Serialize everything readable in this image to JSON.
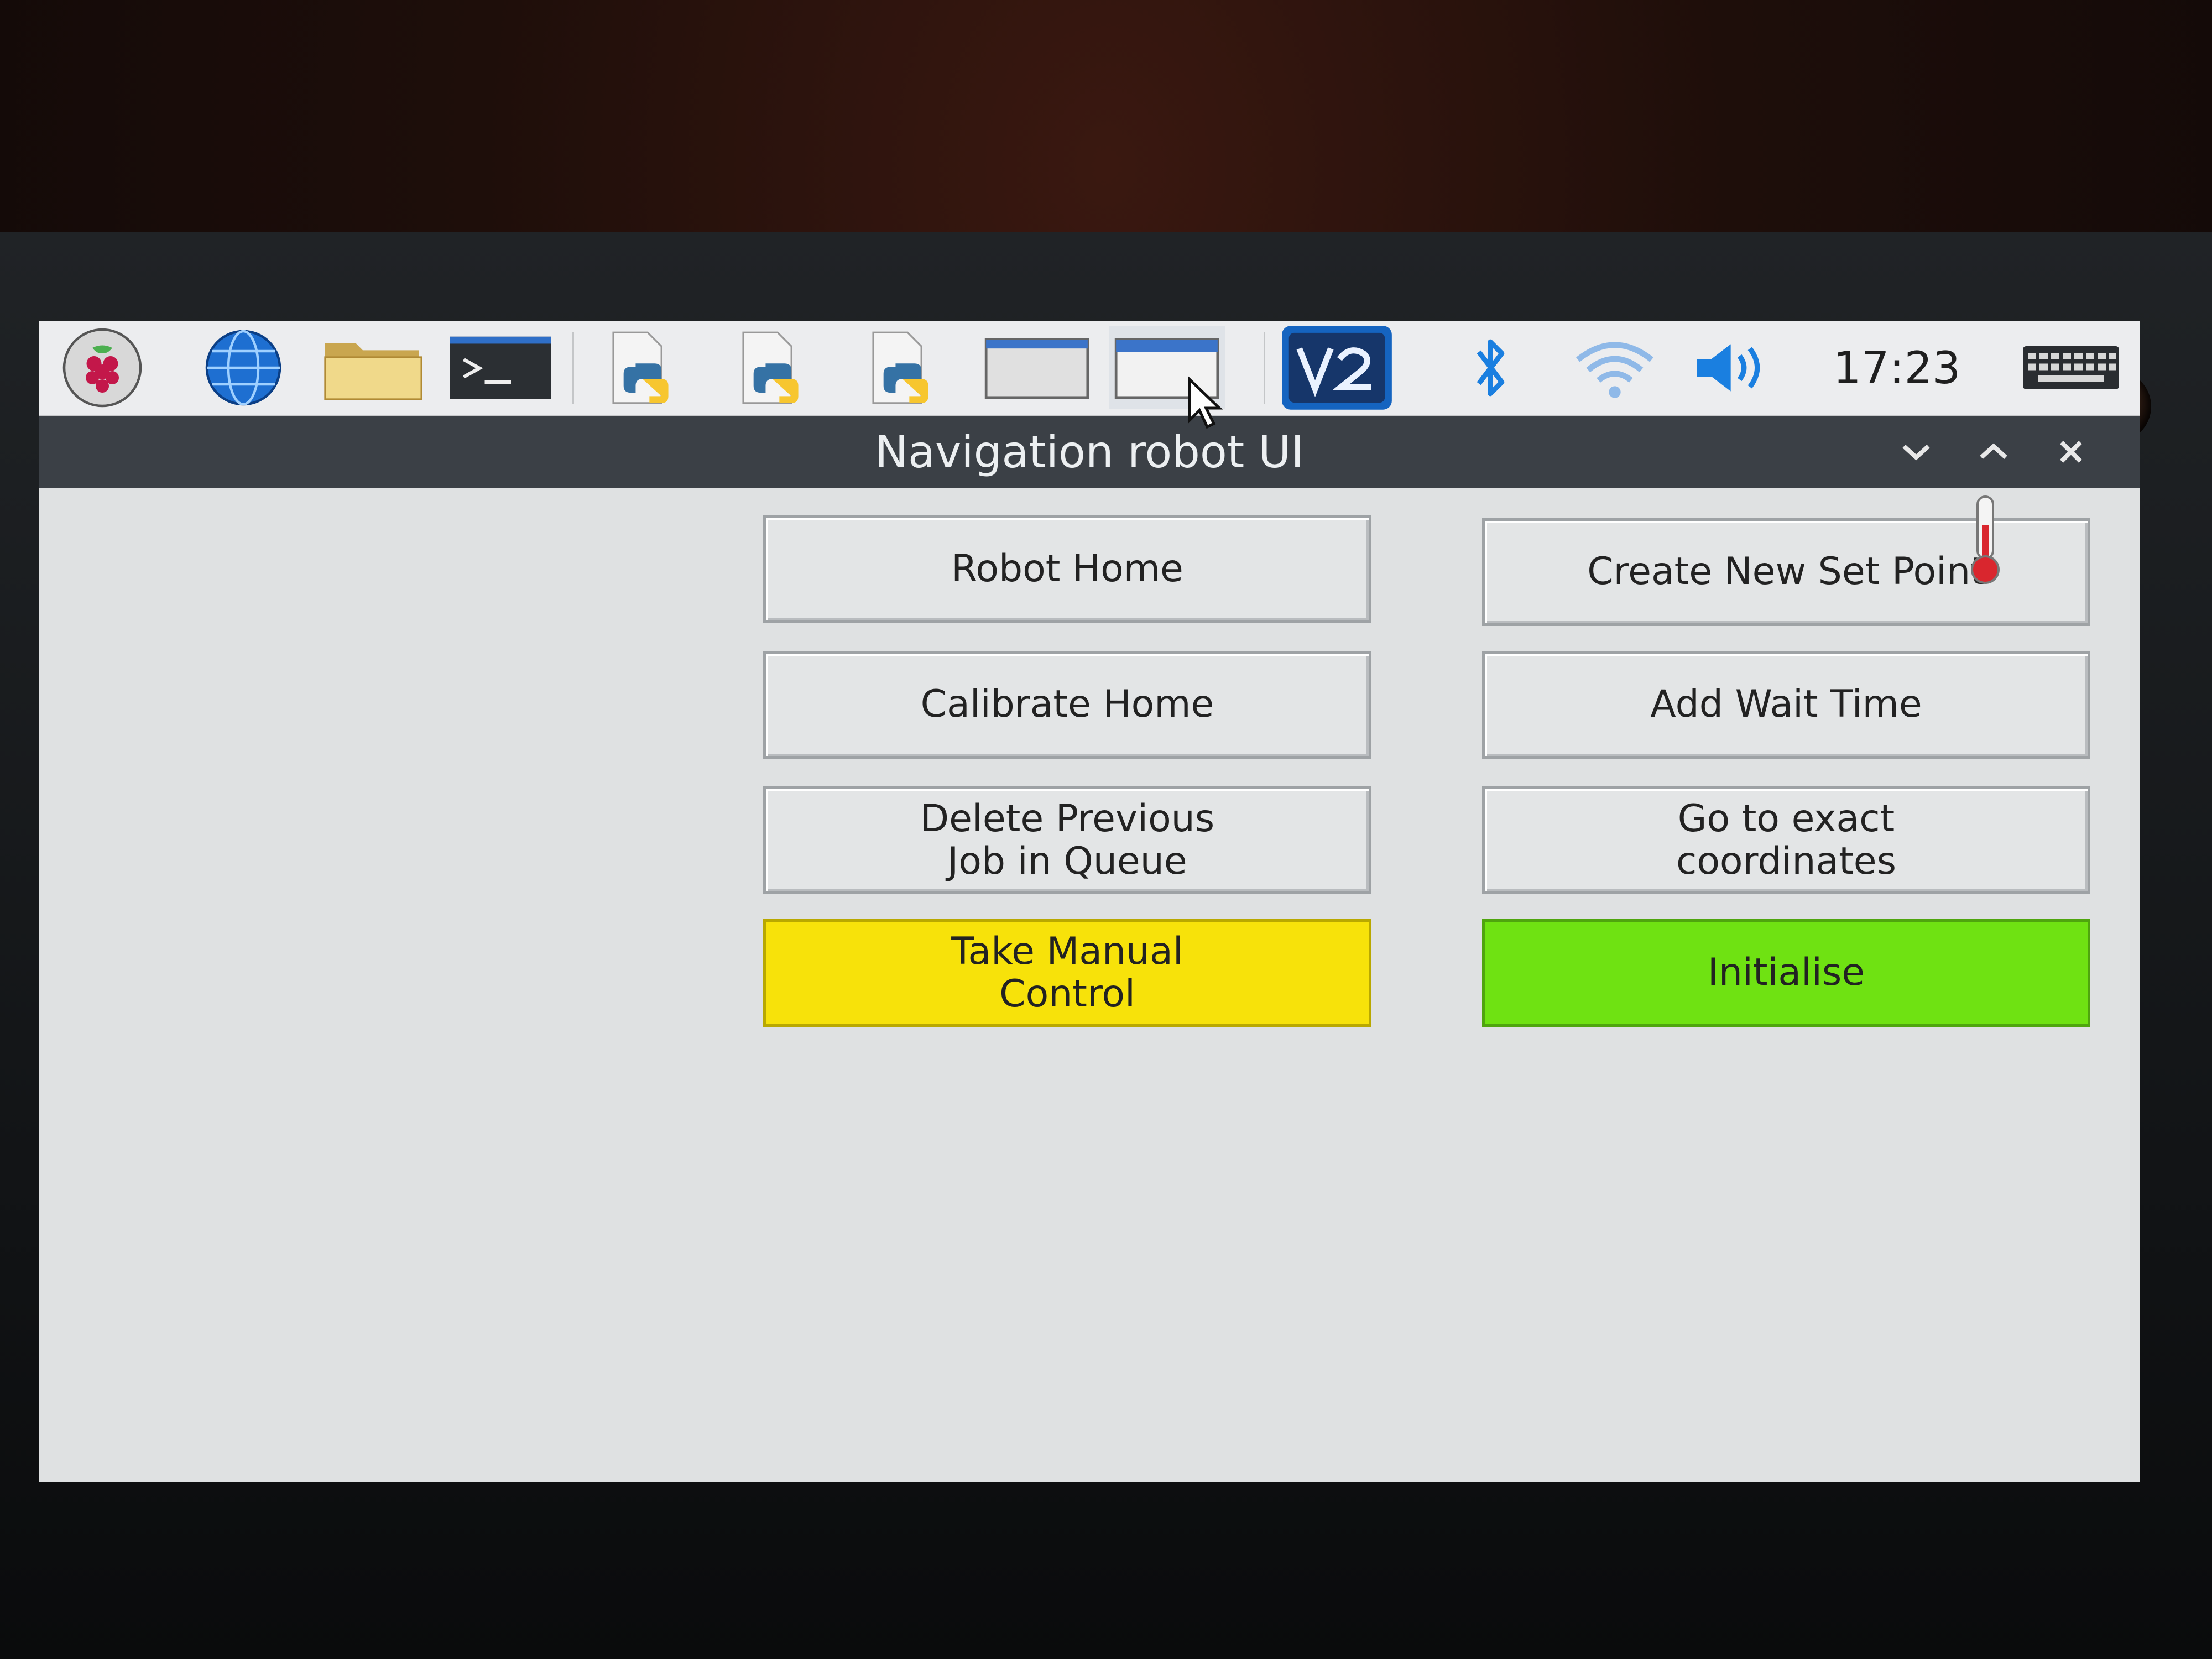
{
  "taskbar": {
    "clock": "17:23",
    "icons": [
      "raspberry-menu-icon",
      "web-browser-icon",
      "file-manager-icon",
      "terminal-icon",
      "python-file-icon",
      "python-file-icon",
      "python-file-icon",
      "window-icon",
      "window-icon",
      "vnc-icon",
      "bluetooth-icon",
      "wifi-icon",
      "volume-icon",
      "keyboard-icon"
    ]
  },
  "window": {
    "title": "Navigation robot UI"
  },
  "buttons": {
    "robot_home": "Robot Home",
    "create_set_point": "Create New Set Point",
    "calibrate_home": "Calibrate Home",
    "add_wait_time": "Add Wait Time",
    "delete_previous": "Delete Previous\nJob in Queue",
    "go_to_coords": "Go to exact\ncoordinates",
    "manual_control": "Take Manual\nControl",
    "initialise": "Initialise"
  },
  "colors": {
    "manual_control_bg": "#f7e20a",
    "initialise_bg": "#6fe212",
    "titlebar_bg": "#3b4046"
  }
}
